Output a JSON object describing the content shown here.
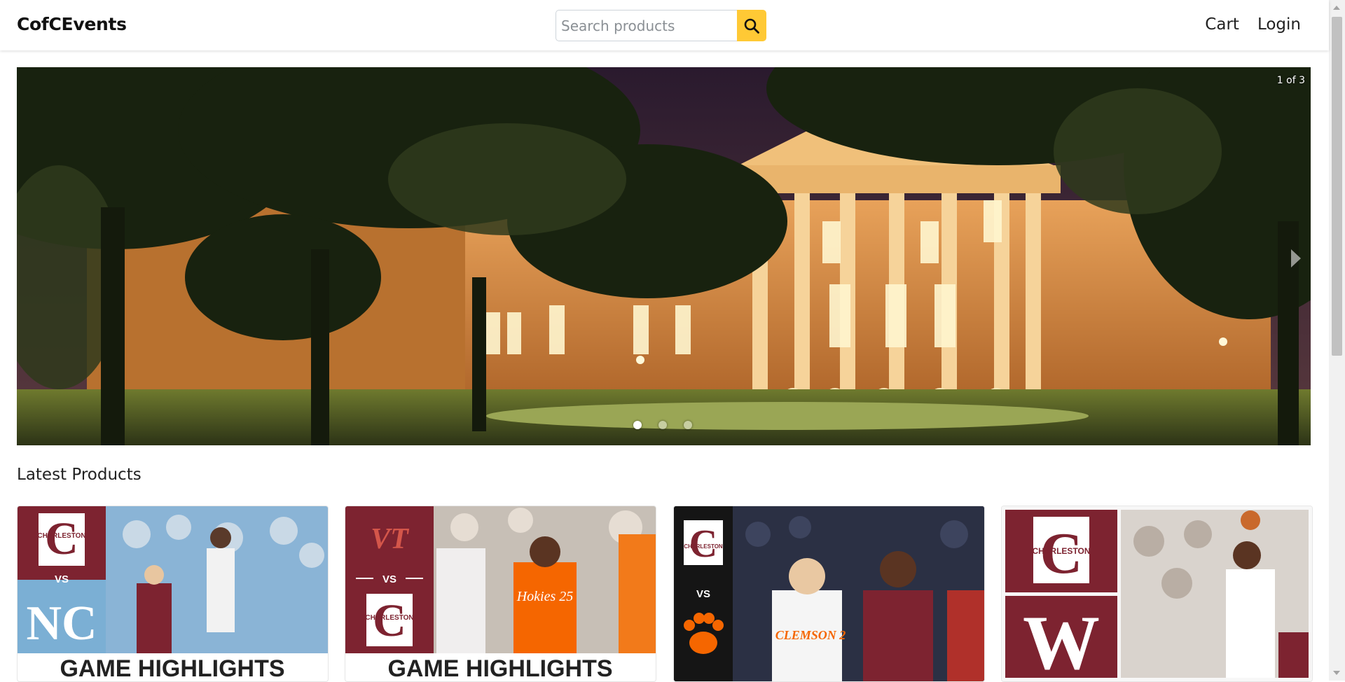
{
  "header": {
    "brand": "CofCEvents",
    "search_placeholder": "Search products",
    "nav": {
      "cart": "Cart",
      "login": "Login"
    }
  },
  "carousel": {
    "counter": "1 of 3",
    "slide_count": 3,
    "active_slide": 1
  },
  "latest": {
    "title": "Latest Products",
    "products": [
      {
        "home_team": "CHARLESTON",
        "vs": "VS",
        "opponent": "NC",
        "banner": "GAME HIGHLIGHTS"
      },
      {
        "home_team": "CHARLESTON",
        "vs": "VS",
        "opponent": "VT",
        "banner": "GAME HIGHLIGHTS",
        "player_jersey": "Hokies 25"
      },
      {
        "home_team": "CHARLESTON",
        "vs": "VS",
        "opponent": "paw-icon",
        "player_jersey": "CLEMSON 2"
      },
      {
        "home_team": "CHARLESTON",
        "opponent": "W"
      }
    ]
  },
  "colors": {
    "accent": "#ffc935",
    "maroon": "#7d2330",
    "carolina_blue": "#7bafd4",
    "clemson_orange": "#f56600"
  }
}
